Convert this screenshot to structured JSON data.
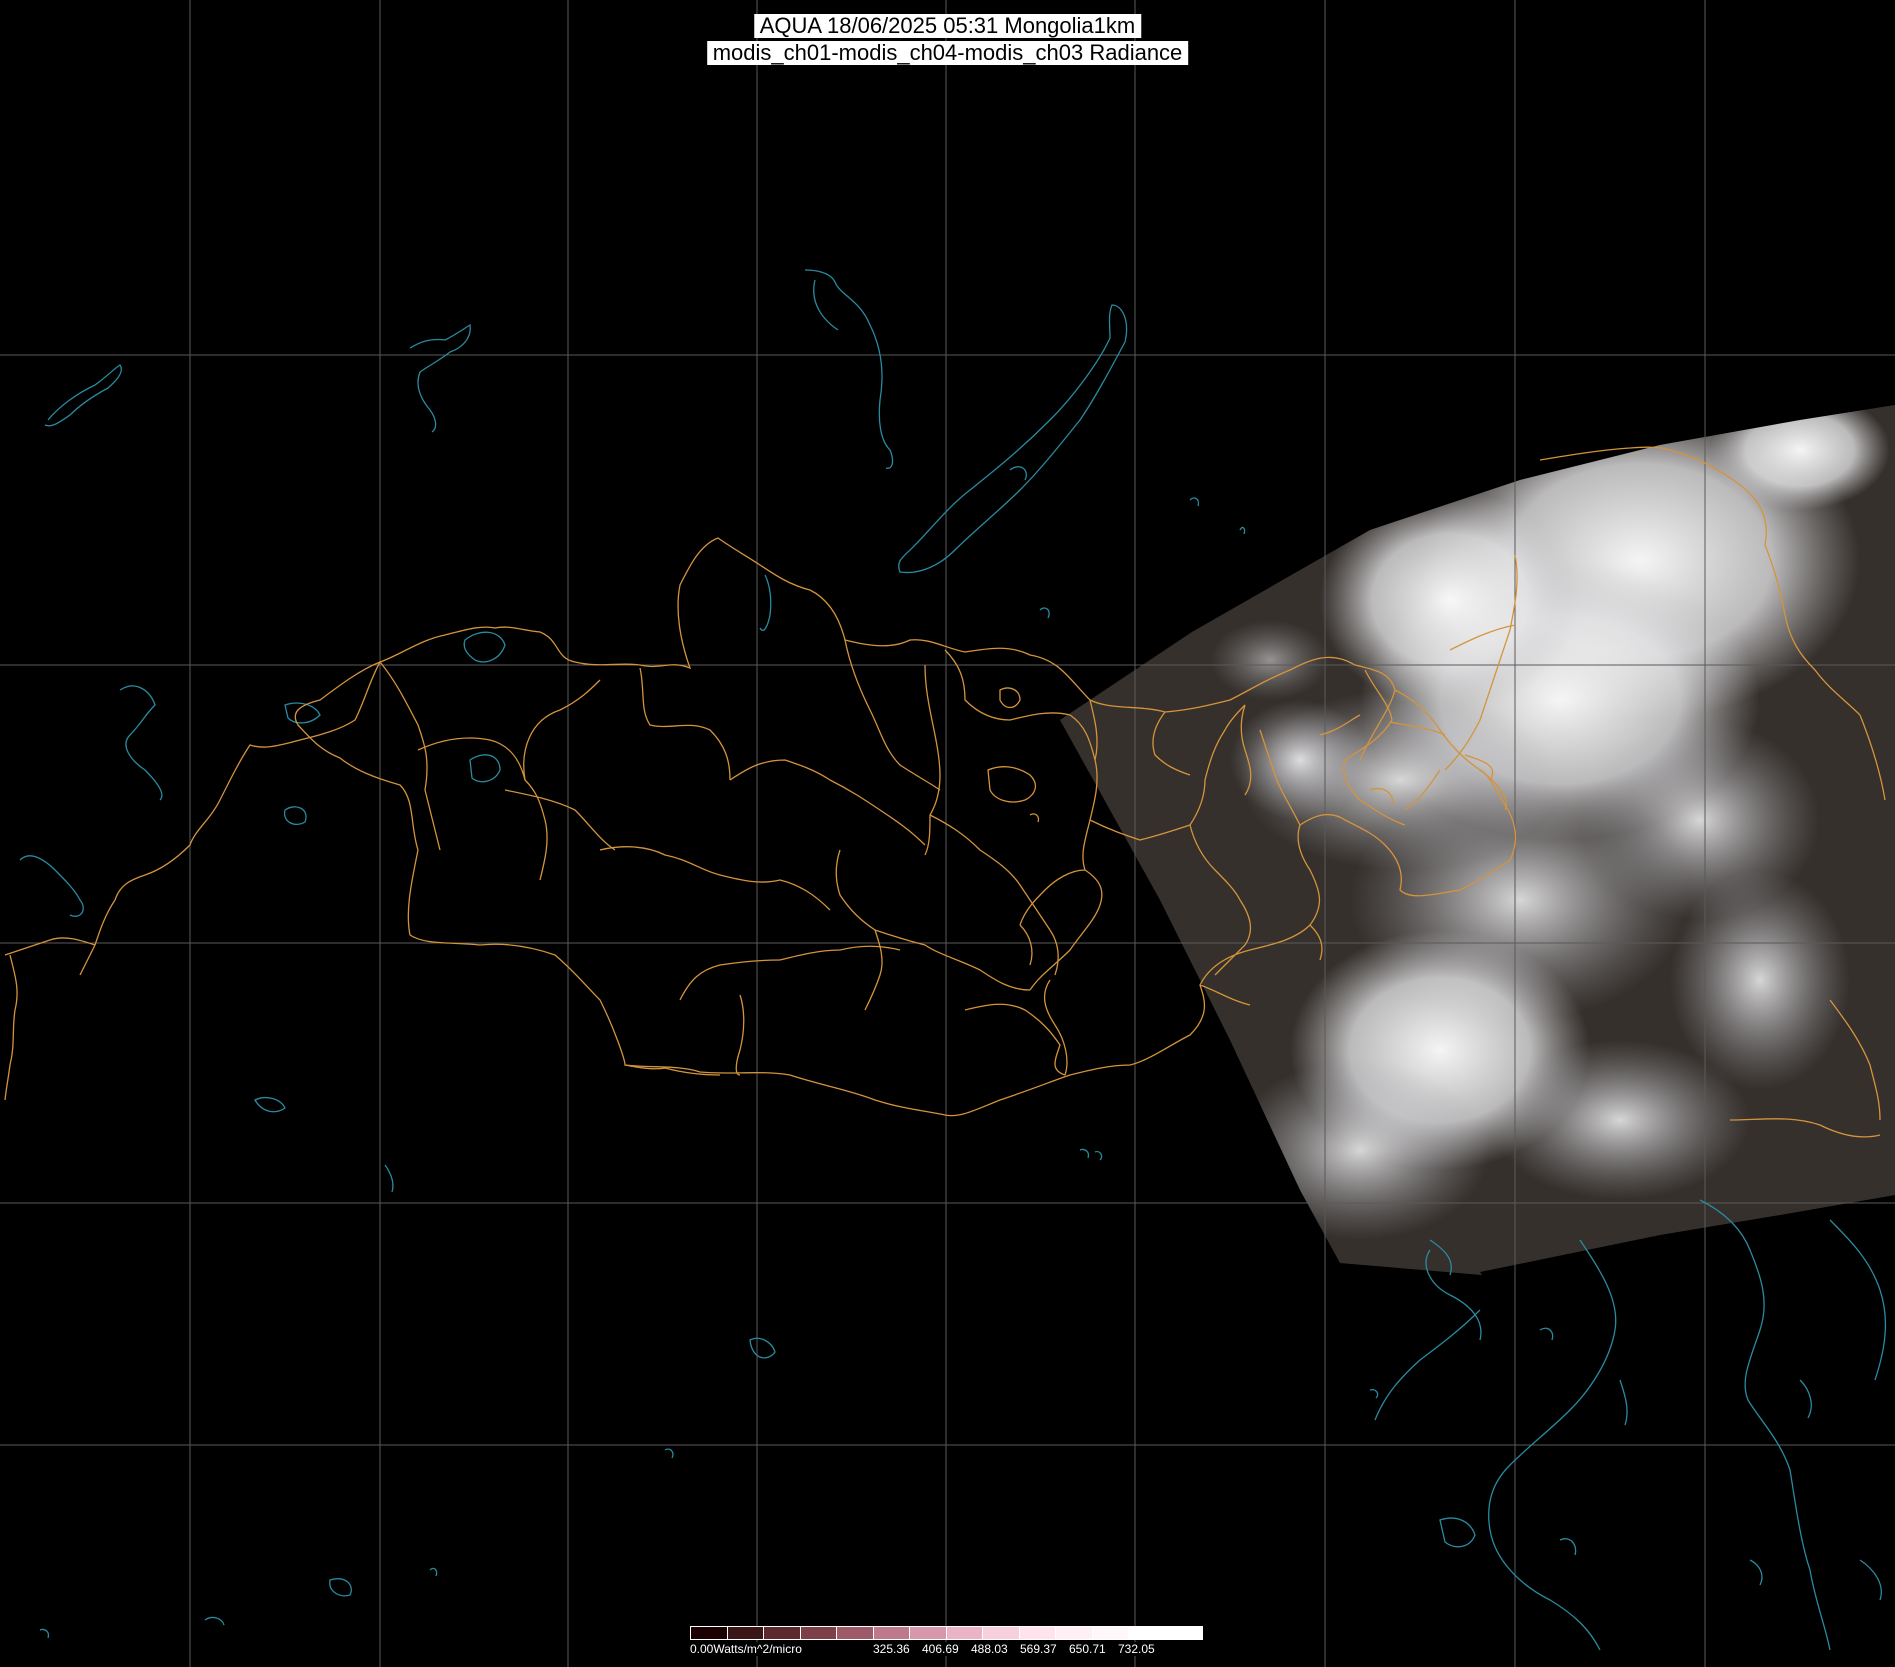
{
  "header": {
    "line1": "AQUA 18/06/2025 05:31 Mongolia1km",
    "line2": "modis_ch01-modis_ch04-modis_ch03 Radiance"
  },
  "colorbar": {
    "unit_label": "0.00Watts/m^2/micro",
    "tick_values": [
      "325.36",
      "406.69",
      "488.03",
      "569.37",
      "650.71",
      "732.05"
    ],
    "colors": [
      "#1a0000",
      "#3a1616",
      "#5c2a2e",
      "#7e4048",
      "#9e5a68",
      "#be7a8c",
      "#d898ac",
      "#eab4c6",
      "#f6d0dc",
      "#ffe4ee",
      "#fff0f6",
      "#fff8fb",
      "#ffffff",
      "#ffffff"
    ]
  },
  "map": {
    "background_color": "#000000",
    "graticule_color": "#5a5a5a",
    "admin_border_color": "#d4943c",
    "coastline_color": "#2a8aa0"
  }
}
